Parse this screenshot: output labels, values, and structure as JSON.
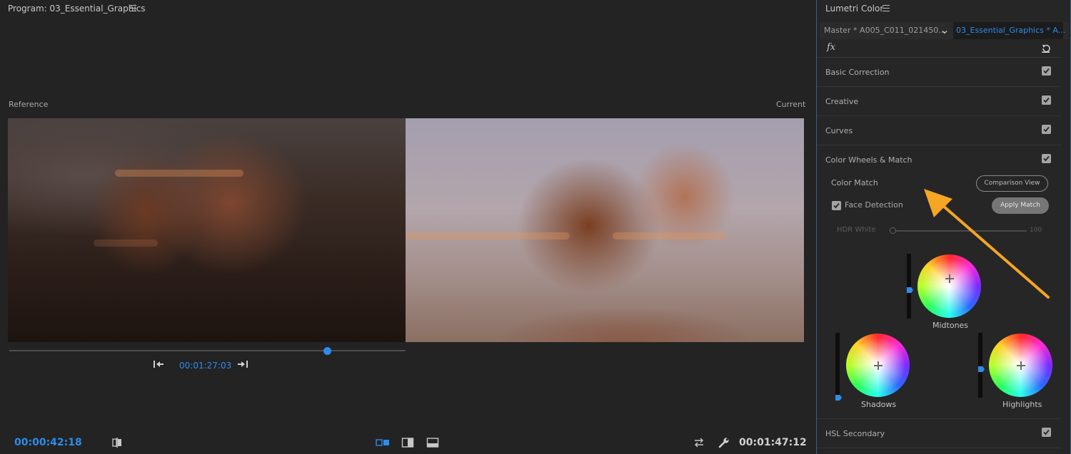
{
  "program": {
    "title": "Program: 03_Essential_Graphics",
    "reference_label": "Reference",
    "current_label": "Current",
    "reference_timecode": "00:01:27:03",
    "playhead_timecode": "00:00:42:18",
    "duration_timecode": "00:01:47:12",
    "scrubber_position": 0.81,
    "icons": [
      "go-to-previous-edit-icon",
      "go-to-next-edit-icon",
      "compare-icon",
      "side-by-side-icon",
      "split-view-icon",
      "swap-icon",
      "wrench-icon",
      "menu-icon"
    ]
  },
  "lumetri": {
    "title": "Lumetri Color",
    "master_clip": "Master * A005_C011_021450...",
    "sequence_clip": "03_Essential_Graphics * A...",
    "fx_label": "fx",
    "sections": {
      "basic_correction": {
        "label": "Basic Correction",
        "enabled": true
      },
      "creative": {
        "label": "Creative",
        "enabled": true
      },
      "curves": {
        "label": "Curves",
        "enabled": true
      },
      "color_wheels": {
        "label": "Color Wheels & Match",
        "enabled": true
      },
      "hsl_secondary": {
        "label": "HSL Secondary",
        "enabled": true
      }
    },
    "color_match": {
      "label": "Color Match",
      "comparison_view_button": "Comparison View",
      "apply_match_button": "Apply Match",
      "face_detection_label": "Face Detection",
      "face_detection_checked": true,
      "hdr_white_label": "HDR White",
      "hdr_white_value": "100"
    },
    "wheels": {
      "midtones": {
        "label": "Midtones",
        "slider_level": 0.56
      },
      "shadows": {
        "label": "Shadows",
        "slider_level": 0.0
      },
      "highlights": {
        "label": "Highlights",
        "slider_level": 0.45
      }
    },
    "accent_color": "#2d8ceb",
    "annotation_arrow_color": "#f5a623"
  }
}
